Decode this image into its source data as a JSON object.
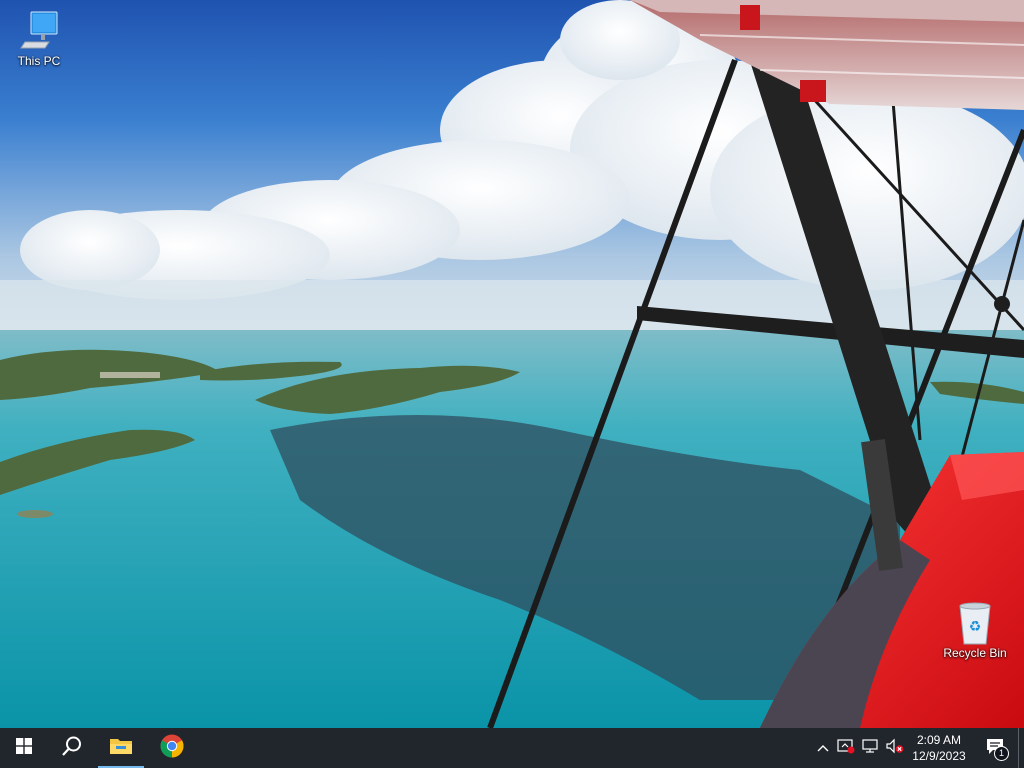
{
  "desktop": {
    "icons": [
      {
        "label": "This PC",
        "icon": "this-pc-icon"
      },
      {
        "label": "Recycle Bin",
        "icon": "recycle-bin-icon"
      }
    ]
  },
  "taskbar": {
    "start": {
      "icon": "windows-logo-icon"
    },
    "search": {
      "icon": "search-icon"
    },
    "pinned": [
      {
        "name": "File Explorer",
        "icon": "file-explorer-icon",
        "active": true
      },
      {
        "name": "Google Chrome",
        "icon": "chrome-icon",
        "active": false
      }
    ],
    "tray": {
      "icons": [
        "chevron-up-icon",
        "windows-security-icon",
        "network-icon",
        "volume-muted-icon"
      ],
      "time": "2:09 AM",
      "date": "12/9/2023",
      "notification_count": "1"
    }
  },
  "colors": {
    "taskbar_bg": "#10141c",
    "active_indicator": "#76b9ed",
    "sea": "#1e9fb0",
    "sky": "#2a67c4",
    "wing_red": "#e8161c"
  }
}
